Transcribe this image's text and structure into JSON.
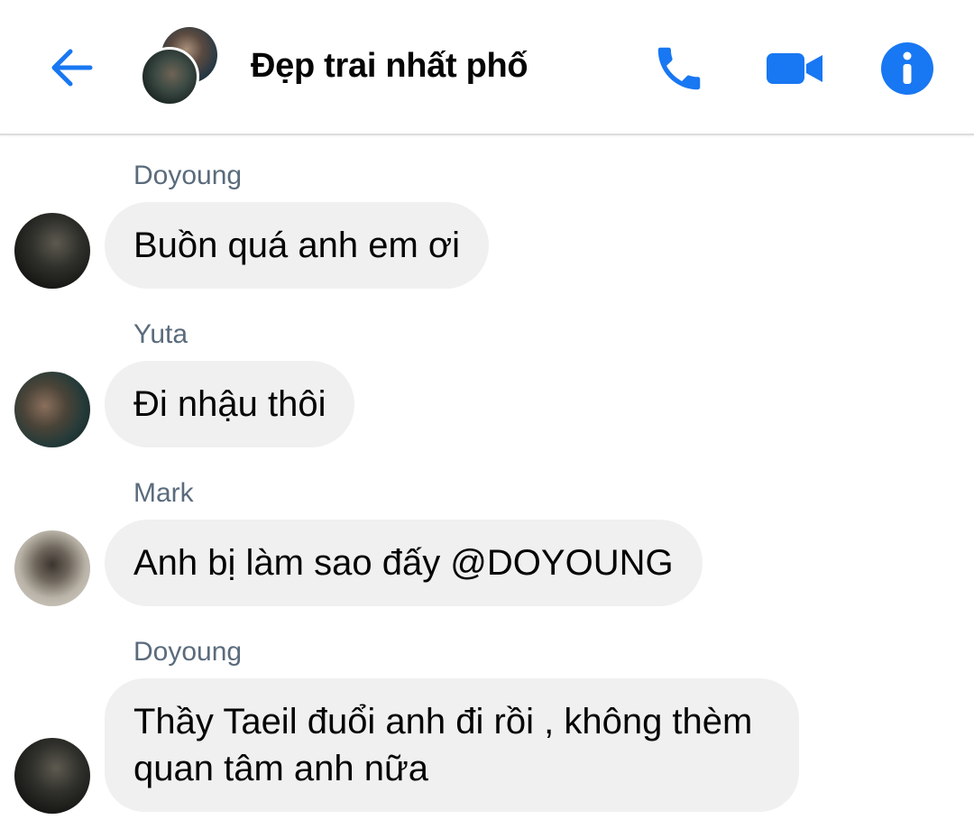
{
  "header": {
    "title": "Đẹp trai nhất phố",
    "icons": [
      "back-arrow-icon",
      "phone-icon",
      "video-camera-icon",
      "info-icon"
    ],
    "accent_color": "#1877f2"
  },
  "messages": [
    {
      "sender": "Doyoung",
      "text": "Buồn quá anh em ơi"
    },
    {
      "sender": "Yuta",
      "text": "Đi nhậu thôi"
    },
    {
      "sender": "Mark",
      "text": "Anh bị làm sao đấy @DOYOUNG"
    },
    {
      "sender": "Doyoung",
      "text": "Thầy Taeil đuổi anh đi rồi , không thèm quan tâm anh nữa"
    }
  ],
  "colors": {
    "bubble": "#f0f0f0",
    "sender_name": "#5a6b7c"
  }
}
